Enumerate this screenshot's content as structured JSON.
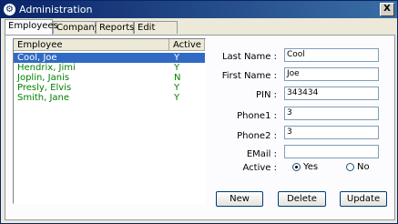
{
  "window": {
    "title": "Administration",
    "icon": "app-gear-icon",
    "close_label": "X"
  },
  "tabs": [
    {
      "label": "Employees",
      "active": true
    },
    {
      "label": "Company",
      "active": false
    },
    {
      "label": "Reports",
      "active": false
    },
    {
      "label": "Edit Time",
      "active": false
    }
  ],
  "employee_list": {
    "columns": [
      "Employee",
      "Active"
    ],
    "rows": [
      {
        "name": "Cool, Joe",
        "active": "Y",
        "selected": true
      },
      {
        "name": "Hendrix, Jimi",
        "active": "Y",
        "selected": false
      },
      {
        "name": "Joplin, Janis",
        "active": "N",
        "selected": false
      },
      {
        "name": "Presly, Elvis",
        "active": "Y",
        "selected": false
      },
      {
        "name": "Smith, Jane",
        "active": "Y",
        "selected": false
      }
    ]
  },
  "form": {
    "last_name": {
      "label": "Last Name :",
      "value": "Cool"
    },
    "first_name": {
      "label": "First Name :",
      "value": "Joe"
    },
    "pin": {
      "label": "PIN :",
      "value": "343434"
    },
    "phone1": {
      "label": "Phone1 :",
      "value": "3"
    },
    "phone2": {
      "label": "Phone2 :",
      "value": "3"
    },
    "email": {
      "label": "EMail :",
      "value": ""
    },
    "active": {
      "label": "Active :",
      "yes_label": "Yes",
      "no_label": "No",
      "selected": "Yes"
    }
  },
  "buttons": {
    "new_label": "New",
    "delete_label": "Delete",
    "update_label": "Update"
  },
  "colors": {
    "titlebar": "#0a246a",
    "selection": "#316ac5",
    "list_text": "#008000"
  }
}
